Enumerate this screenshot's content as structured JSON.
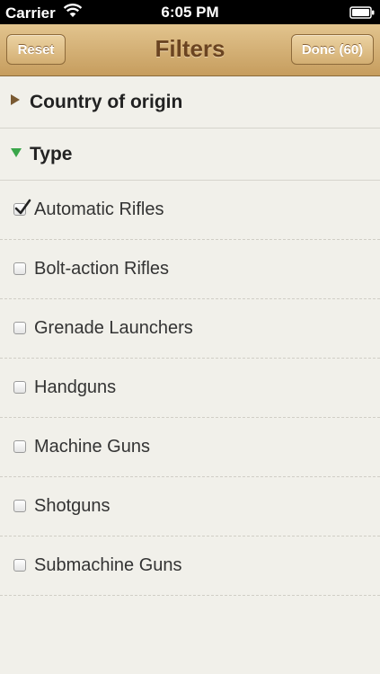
{
  "status_bar": {
    "carrier": "Carrier",
    "time": "6:05 PM"
  },
  "nav": {
    "reset_label": "Reset",
    "title": "Filters",
    "done_label": "Done (60)"
  },
  "sections": [
    {
      "label": "Country of origin",
      "expanded": false
    },
    {
      "label": "Type",
      "expanded": true
    }
  ],
  "items": [
    {
      "label": "Automatic Rifles",
      "checked": true
    },
    {
      "label": "Bolt-action Rifles",
      "checked": false
    },
    {
      "label": "Grenade Launchers",
      "checked": false
    },
    {
      "label": "Handguns",
      "checked": false
    },
    {
      "label": "Machine Guns",
      "checked": false
    },
    {
      "label": "Shotguns",
      "checked": false
    },
    {
      "label": "Submachine Guns",
      "checked": false
    }
  ],
  "colors": {
    "collapsed_arrow": "#7a5a32",
    "expanded_arrow": "#3aa64a",
    "nav_title": "#6b4421"
  },
  "icons": [
    "wifi-icon",
    "battery-icon",
    "disclosure-right-icon",
    "disclosure-down-icon",
    "checkmark-icon"
  ]
}
